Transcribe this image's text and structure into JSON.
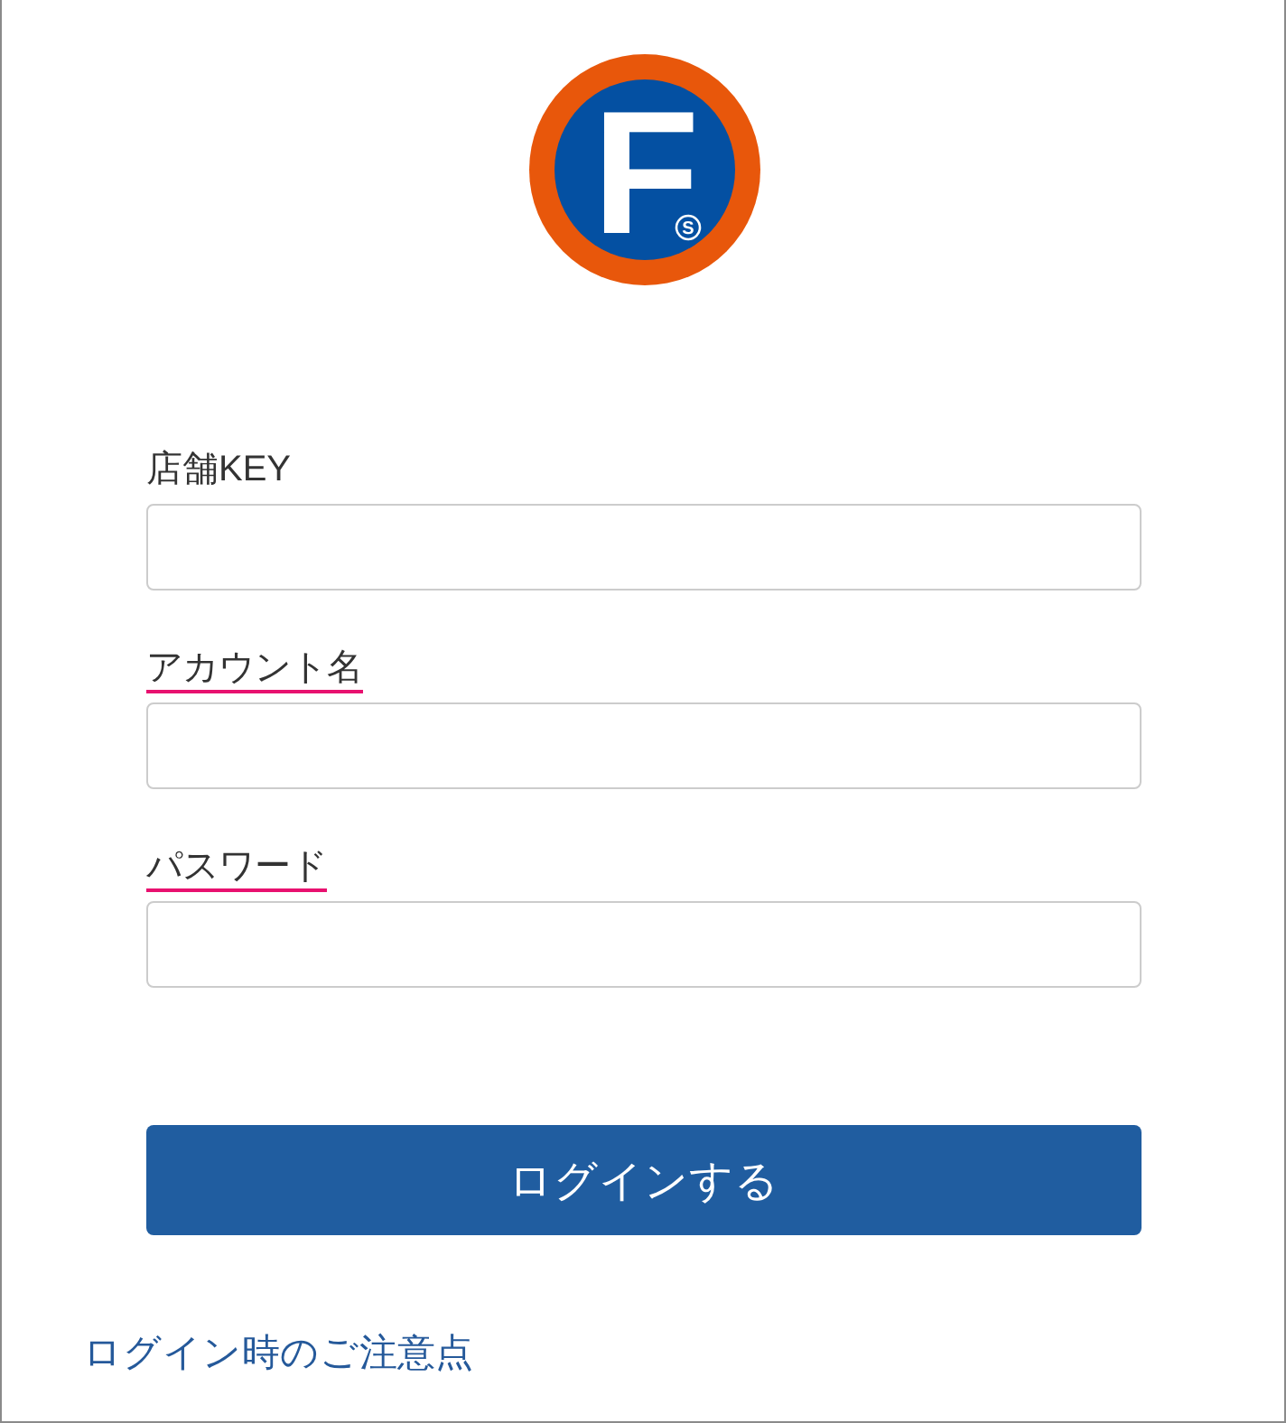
{
  "logo": {
    "letter": "F",
    "mark": "S"
  },
  "fields": [
    {
      "label": "店舗KEY",
      "underlined": false
    },
    {
      "label": "アカウント名",
      "underlined": true
    },
    {
      "label": "パスワード",
      "underlined": true
    }
  ],
  "login_button": {
    "label": "ログインする"
  },
  "notice_link": {
    "label": "ログイン時のご注意点"
  }
}
